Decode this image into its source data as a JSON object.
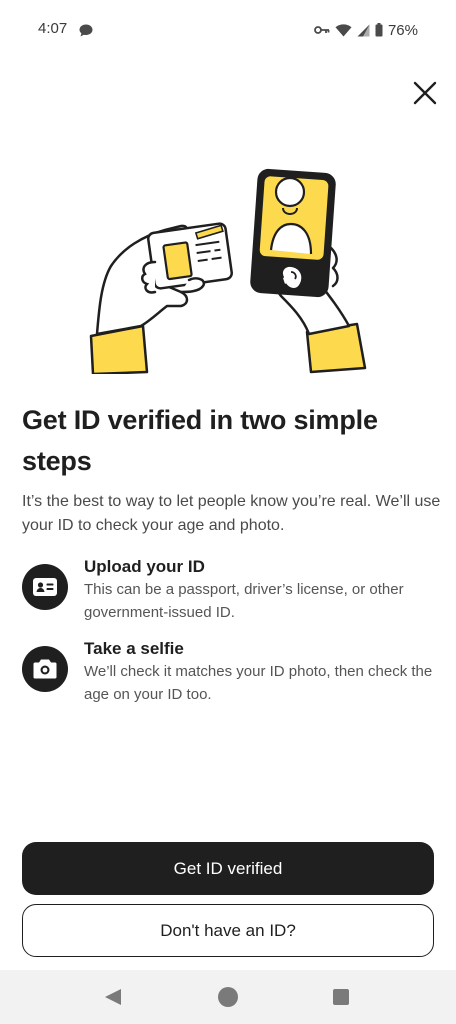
{
  "status_bar": {
    "time": "4:07",
    "battery": "76%"
  },
  "icons": {
    "close": "close-icon",
    "chat": "chat-bubble-icon",
    "key": "key-icon",
    "wifi": "wifi-icon",
    "signal": "cell-signal-icon",
    "battery": "battery-icon",
    "id_card": "id-card-icon",
    "camera": "camera-icon"
  },
  "colors": {
    "accent_yellow": "#FDD94E",
    "primary": "#1F1F1F"
  },
  "title": "Get ID verified in two simple steps",
  "intro": "It’s the best to way to let people know you’re real. We’ll use your ID to check your age and photo.",
  "steps": [
    {
      "title": "Upload your ID",
      "description": "This can be a passport, driver’s license, or other government-issued ID."
    },
    {
      "title": "Take a selfie",
      "description": "We’ll check it matches your ID photo, then check the age on your ID too."
    }
  ],
  "buttons": {
    "primary": "Get ID verified",
    "secondary": "Don't have an ID?"
  }
}
